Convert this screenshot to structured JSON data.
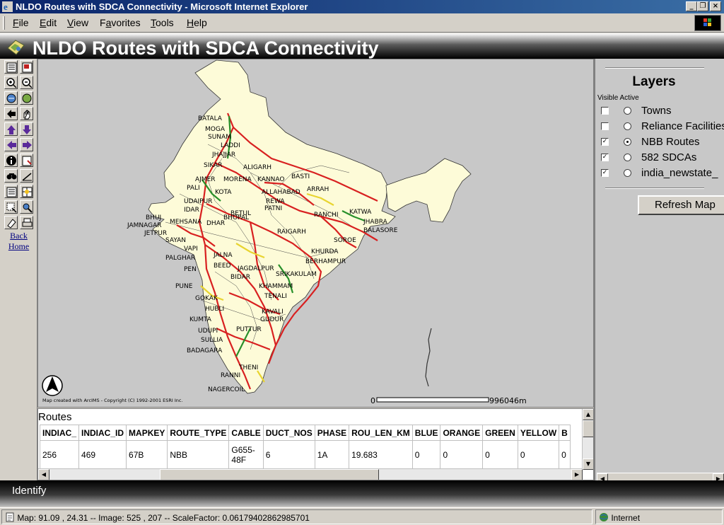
{
  "window": {
    "title": "NLDO Routes with SDCA Connectivity - Microsoft Internet Explorer",
    "controls": [
      "_",
      "❐",
      "×"
    ]
  },
  "menubar": {
    "items": [
      {
        "accel": "F",
        "rest": "ile"
      },
      {
        "accel": "E",
        "rest": "dit"
      },
      {
        "accel": "V",
        "rest": "iew"
      },
      {
        "pre": "F",
        "accel": "a",
        "rest": "vorites"
      },
      {
        "accel": "T",
        "rest": "ools"
      },
      {
        "accel": "H",
        "rest": "elp"
      }
    ]
  },
  "app": {
    "title": "NLDO Routes with SDCA Connectivity"
  },
  "toolbar": {
    "tools": [
      {
        "name": "toggle-legend-icon"
      },
      {
        "name": "overview-map-icon"
      },
      {
        "name": "zoom-in-icon"
      },
      {
        "name": "zoom-out-icon"
      },
      {
        "name": "zoom-full-extent-icon"
      },
      {
        "name": "zoom-active-layer-icon"
      },
      {
        "name": "zoom-last-extent-icon"
      },
      {
        "name": "pan-icon"
      },
      {
        "name": "pan-north-icon"
      },
      {
        "name": "pan-south-icon"
      },
      {
        "name": "pan-west-icon"
      },
      {
        "name": "pan-east-icon"
      },
      {
        "name": "identify-icon"
      },
      {
        "name": "hyperlink-icon"
      },
      {
        "name": "find-icon"
      },
      {
        "name": "measure-icon"
      },
      {
        "name": "select-by-rectangle-icon"
      },
      {
        "name": "buffer-icon"
      },
      {
        "name": "select-by-line-icon"
      },
      {
        "name": "query-icon"
      },
      {
        "name": "clear-selection-icon"
      },
      {
        "name": "print-icon"
      }
    ],
    "back_label": "Back",
    "home_label": "Home"
  },
  "map": {
    "credit": "Map created with ArcIMS - Copyright (C) 1992-2001 ESRI Inc.",
    "scale_start": "0",
    "scale_end": "996046m",
    "cities": [
      "BATALA",
      "MOGA",
      "SUNAM",
      "LADDI",
      "JHAJJAR",
      "SIKAR",
      "ALIGARH",
      "AJMER",
      "MORENA",
      "KANNAO",
      "BASTI",
      "PALI",
      "KOTA",
      "ALLAHABAD",
      "ARRAH",
      "UDAIPUR",
      "REWA",
      "PATNI",
      "IDAR",
      "BHOPAL",
      "RANCHI",
      "KATWA",
      "BHUJ",
      "MEHSANA",
      "DHAR",
      "BETUL",
      "JHABRA",
      "JAMNAGAR",
      "JETPUR",
      "RAIGARH",
      "BALASORE",
      "SAYAN",
      "SOROE",
      "VAPI",
      "KHURDA",
      "PALGHAR",
      "JALNA",
      "BERHAMPUR",
      "PEN",
      "BEED",
      "JAGDALPUR",
      "BIDAR",
      "SRIKAKULAM",
      "KHAMMAM",
      "PUNE",
      "GOKAK",
      "TENALI",
      "HUBLI",
      "KAVALI",
      "KUMTA",
      "GUDUR",
      "UDUPI",
      "PUTTUR",
      "SULLIA",
      "BADAGARA",
      "THENI",
      "RANNI",
      "NAGERCOIL"
    ]
  },
  "layers": {
    "title": "Layers",
    "subheader": "Visible Active",
    "items": [
      {
        "name": "Towns",
        "visible": false,
        "active": false
      },
      {
        "name": "Reliance Facilities",
        "visible": false,
        "active": false
      },
      {
        "name": "NBB Routes",
        "visible": true,
        "active": true
      },
      {
        "name": "582 SDCAs",
        "visible": true,
        "active": false
      },
      {
        "name": "india_newstate_",
        "visible": true,
        "active": false
      }
    ],
    "refresh_label": "Refresh Map"
  },
  "routes": {
    "title": "Routes",
    "columns": [
      "INDIAC_",
      "INDIAC_ID",
      "MAPKEY",
      "ROUTE_TYPE",
      "CABLE",
      "DUCT_NOS",
      "PHASE",
      "ROU_LEN_KM",
      "BLUE",
      "ORANGE",
      "GREEN",
      "YELLOW",
      "B"
    ],
    "rows": [
      [
        "256",
        "469",
        "67B",
        "NBB",
        "G655-48F",
        "6",
        "1A",
        "19.683",
        "0",
        "0",
        "0",
        "0",
        "0"
      ]
    ]
  },
  "identify": {
    "label": "Identify"
  },
  "status": {
    "text": "Map: 91.09 , 24.31 -- Image: 525 , 207 -- ScaleFactor: 0.06179402862985701",
    "zone": "Internet"
  },
  "colors": {
    "title_bar_start": "#0a246a",
    "title_bar_end": "#3a6ea5",
    "link": "#000080",
    "land": "#fdfbd8",
    "route_red": "#d82020",
    "route_green": "#28902a",
    "route_yellow": "#e8d430"
  }
}
